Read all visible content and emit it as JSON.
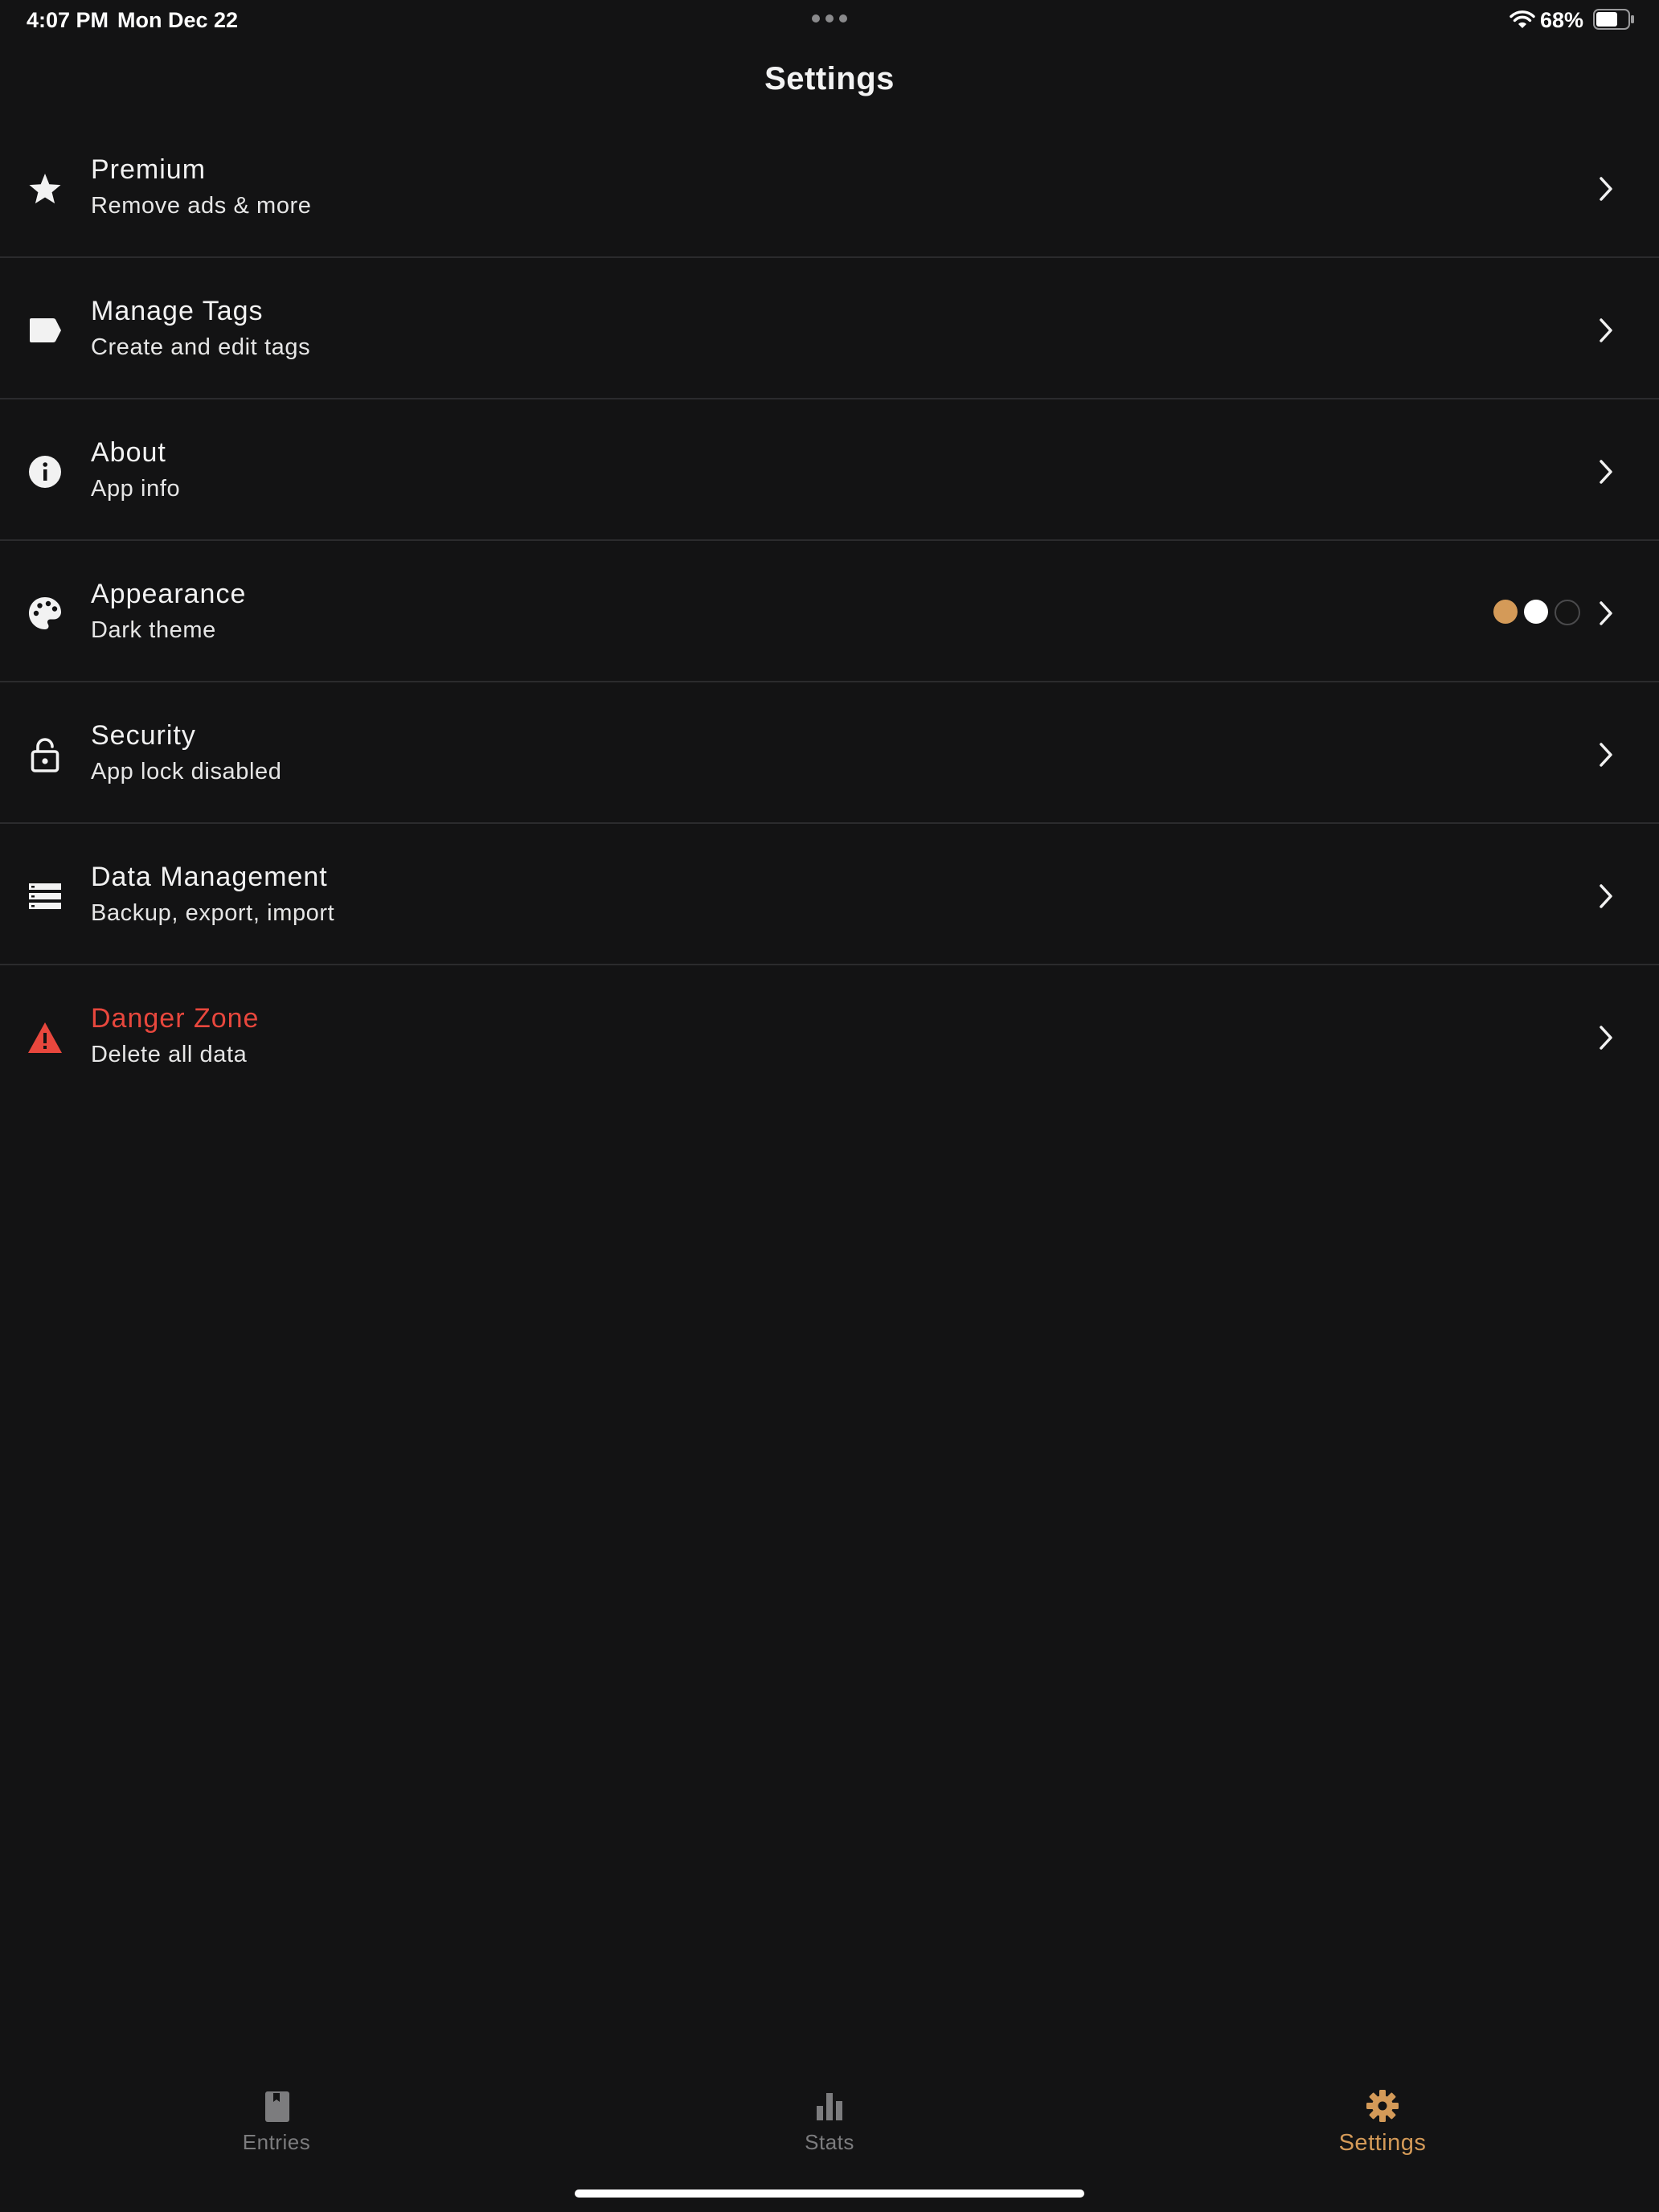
{
  "status_bar": {
    "time": "4:07 PM",
    "date": "Mon Dec 22",
    "battery_percent": "68%",
    "battery_level": 0.68
  },
  "page": {
    "title": "Settings"
  },
  "settings": [
    {
      "title": "Premium",
      "subtitle": "Remove ads & more",
      "icon": "star-icon"
    },
    {
      "title": "Manage Tags",
      "subtitle": "Create and edit tags",
      "icon": "tag-icon"
    },
    {
      "title": "About",
      "subtitle": "App info",
      "icon": "info-icon"
    },
    {
      "title": "Appearance",
      "subtitle": "Dark theme",
      "icon": "palette-icon"
    },
    {
      "title": "Security",
      "subtitle": "App lock disabled",
      "icon": "unlocked-padlock-icon"
    },
    {
      "title": "Data Management",
      "subtitle": "Backup, export, import",
      "icon": "storage-icon"
    },
    {
      "title": "Danger Zone",
      "subtitle": "Delete all data",
      "icon": "warning-icon"
    }
  ],
  "theme_swatches": [
    "#d49a58",
    "#ffffff",
    "#141414"
  ],
  "tabs": [
    {
      "label": "Entries",
      "icon": "book-icon",
      "active": false
    },
    {
      "label": "Stats",
      "icon": "bar-chart-icon",
      "active": false
    },
    {
      "label": "Settings",
      "icon": "gear-icon",
      "active": true
    }
  ],
  "colors": {
    "background": "#131314",
    "accent": "#d49a58",
    "danger": "#e8473d",
    "inactive_tab": "#7c7c7e"
  }
}
